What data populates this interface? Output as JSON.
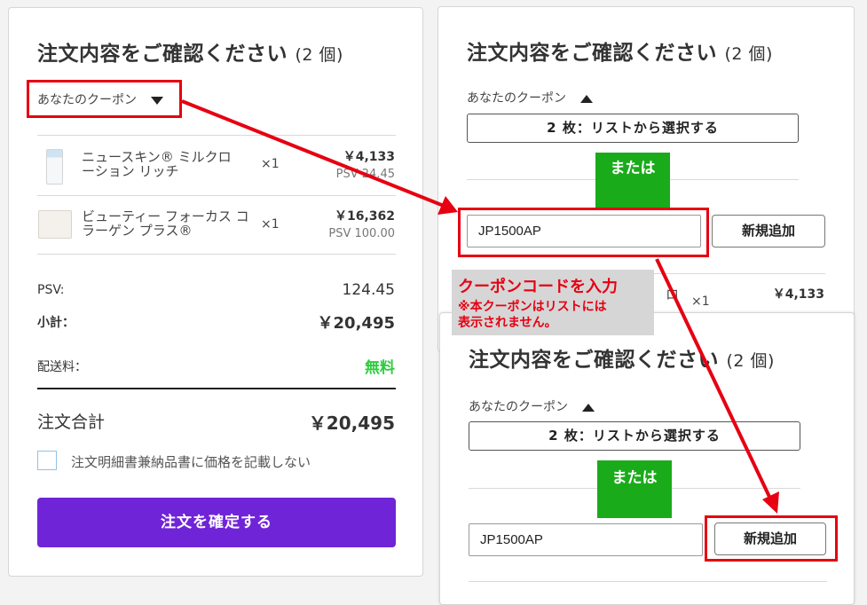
{
  "left_panel": {
    "title": "注文内容をご確認ください",
    "count": "(2 個)",
    "coupon_toggle": "あなたのクーポン",
    "items": [
      {
        "name": "ニュースキン® ミルクローション リッチ",
        "qty": "×1",
        "price": "￥4,133",
        "psv": "PSV 24.45"
      },
      {
        "name": "ビューティー フォーカス コラーゲン プラス®",
        "qty": "×1",
        "price": "￥16,362",
        "psv": "PSV 100.00"
      }
    ],
    "psv_label": "PSV:",
    "psv_value": "124.45",
    "subtotal_label": "小計：",
    "subtotal_value": "￥20,495",
    "shipping_label": "配送料：",
    "shipping_value": "無料",
    "total_label": "注文合計",
    "total_value": "￥20,495",
    "checkbox_label": "注文明細書兼納品書に価格を記載しない",
    "confirm_button": "注文を確定する"
  },
  "right_top_panel": {
    "title": "注文内容をご確認ください",
    "count": "(2 個)",
    "coupon_toggle": "あなたのクーポン",
    "select_button": "2 枚：リストから選択する",
    "or_label": "または",
    "code_input_value": "JP1500AP",
    "add_button": "新規追加",
    "partial_item_tail": "ロ",
    "partial_qty": "×1",
    "partial_price": "￥4,133"
  },
  "right_bottom_panel": {
    "title": "注文内容をご確認ください",
    "count": "(2 個)",
    "coupon_toggle": "あなたのクーポン",
    "select_button": "2 枚：リストから選択する",
    "or_label": "または",
    "code_input_value": "JP1500AP",
    "add_button": "新規追加"
  },
  "annotation": {
    "heading": "クーポンコードを入力",
    "note_line1": "※本クーポンはリストには",
    "note_line2": "表示されません。"
  },
  "colors": {
    "accent_purple": "#7024d8",
    "free_green": "#2ecc40",
    "or_green": "#1aab1a",
    "callout_red": "#e60012",
    "checkbox_border": "#8fc3e8"
  }
}
